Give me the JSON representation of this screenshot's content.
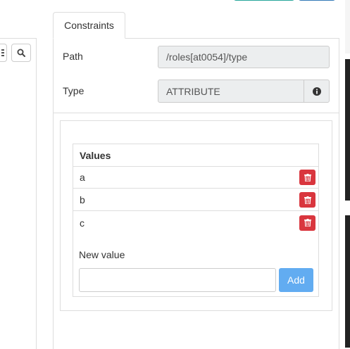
{
  "tab": {
    "label": "Constraints"
  },
  "path": {
    "label": "Path",
    "value": "/roles[at0054]/type"
  },
  "type": {
    "label": "Type",
    "value": "ATTRIBUTE",
    "info_icon": "info-circle-icon"
  },
  "values": {
    "header": "Values",
    "items": [
      "a",
      "b",
      "c"
    ],
    "delete_icon": "trash-icon"
  },
  "new_value": {
    "label": "New value",
    "placeholder": "",
    "add_label": "Add"
  },
  "colors": {
    "danger": "#d9363e",
    "primary_light": "#62acf1",
    "readonly_bg": "#eceeef"
  }
}
